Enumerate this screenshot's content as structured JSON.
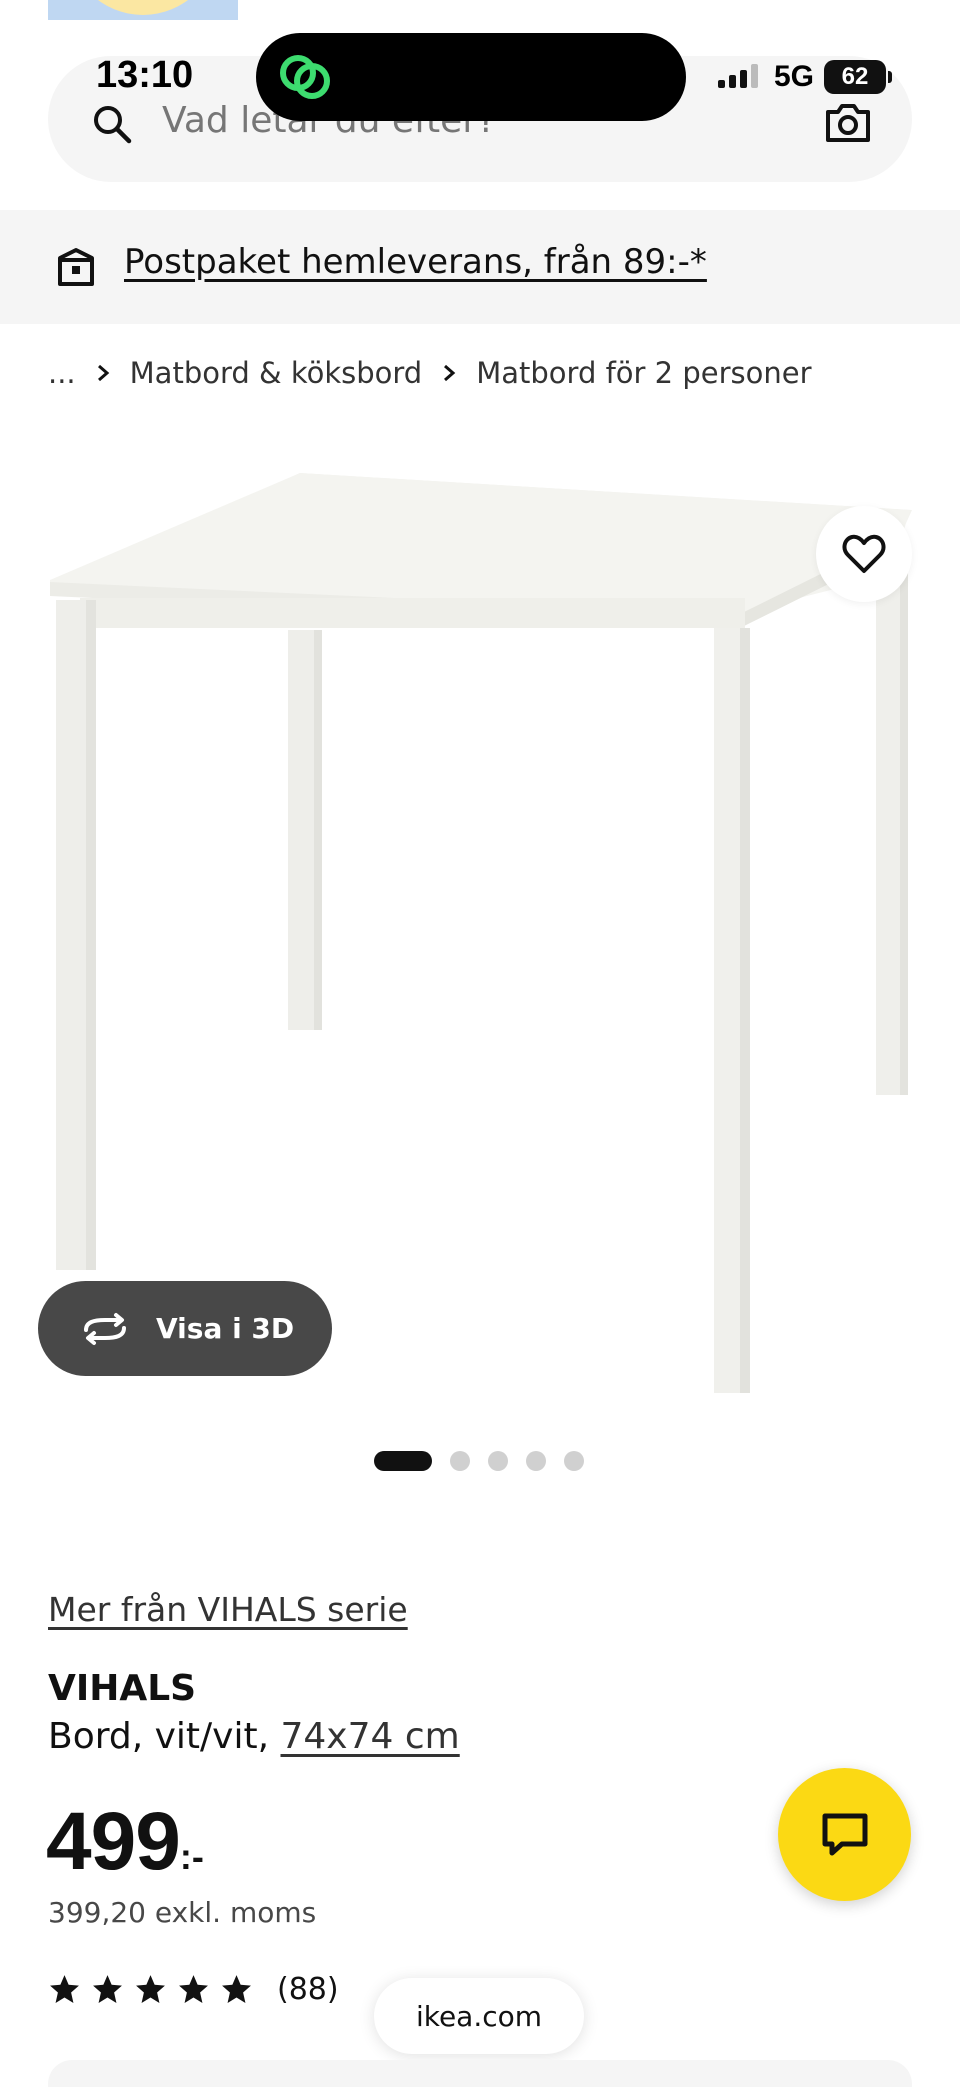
{
  "status_bar": {
    "time": "13:10",
    "network": "5G",
    "battery": "62"
  },
  "search": {
    "placeholder": "Vad letar du efter?"
  },
  "banner": {
    "text": "Postpaket hemleverans, från 89:-*"
  },
  "breadcrumb": {
    "items": [
      "...",
      "Matbord & köksbord",
      "Matbord för 2 personer"
    ]
  },
  "gallery": {
    "view3d_label": "Visa i 3D",
    "image_count": 5,
    "active_index": 0
  },
  "product": {
    "series_link": "Mer från VIHALS serie",
    "name": "VIHALS",
    "description": "Bord, vit/vit, ",
    "size": "74x74 cm",
    "price": "499",
    "price_suffix": ":-",
    "price_excl_vat": "399,20 exkl. moms",
    "rating_stars": 5,
    "rating_count": "(88)"
  },
  "browser": {
    "domain": "ikea.com"
  },
  "colors": {
    "accent_yellow": "#fbd914",
    "dark_button": "#484848",
    "banner_bg": "#f5f5f5"
  }
}
